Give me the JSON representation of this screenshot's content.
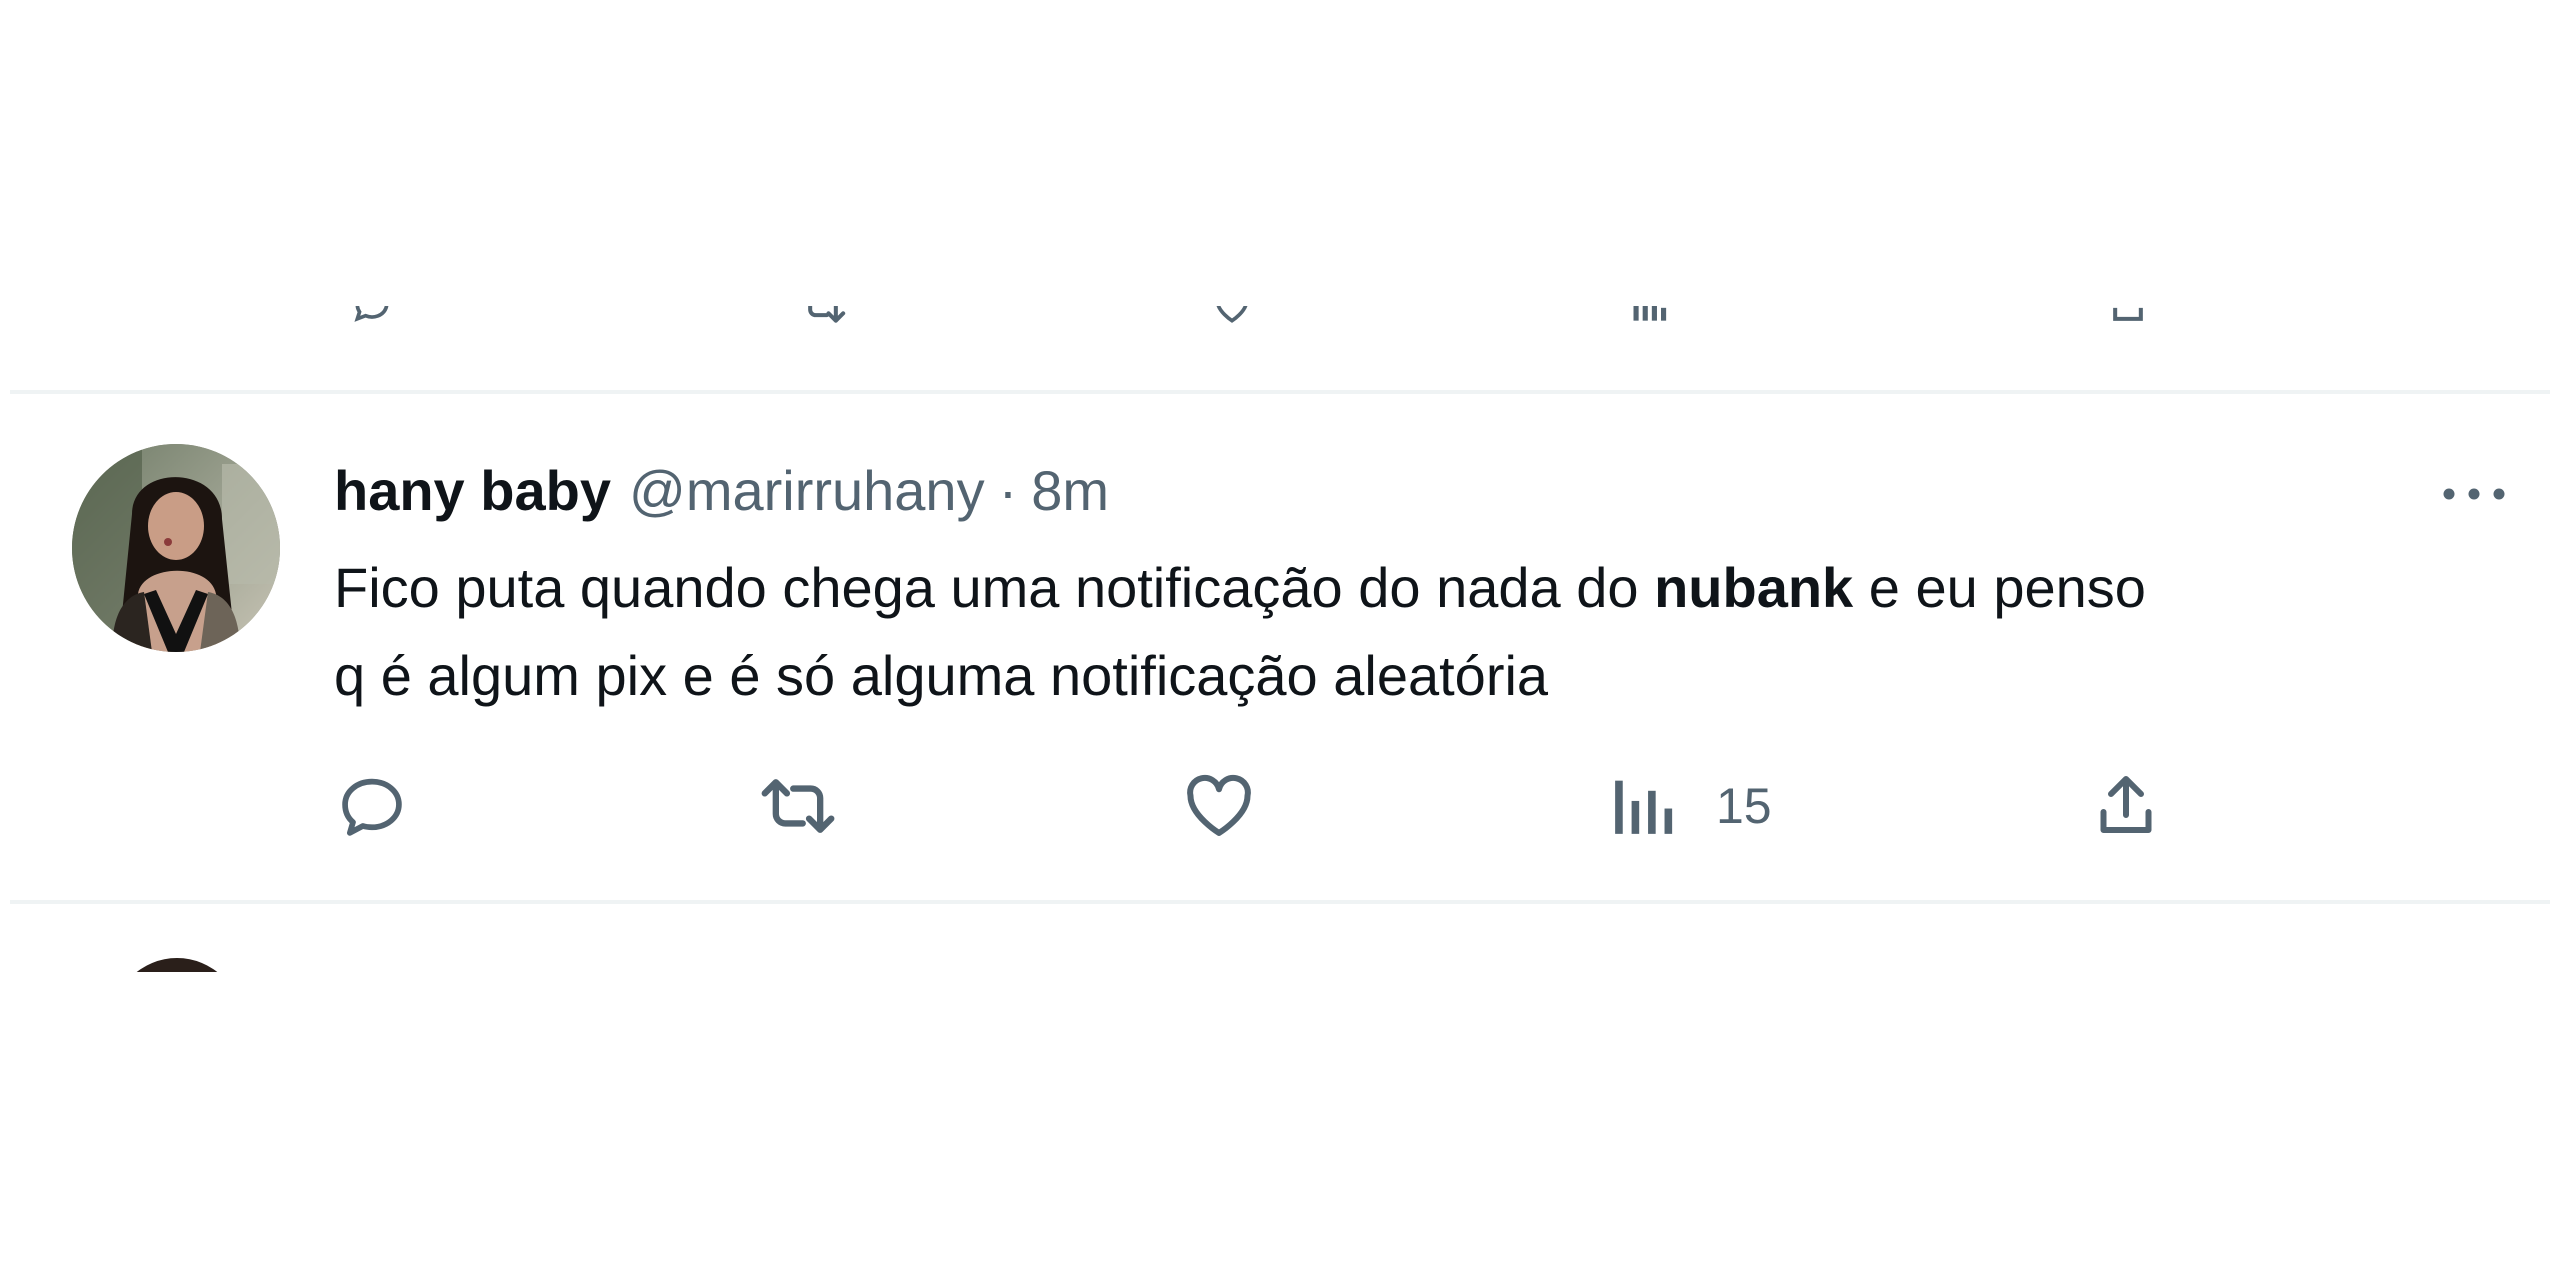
{
  "previous_tweet": {
    "actions": [
      {
        "icon": "reply-icon"
      },
      {
        "icon": "retweet-icon"
      },
      {
        "icon": "like-icon"
      },
      {
        "icon": "views-icon"
      },
      {
        "icon": "share-icon"
      }
    ]
  },
  "tweet": {
    "display_name": "hany baby",
    "handle": "@marirruhany",
    "separator": "·",
    "time": "8m",
    "text_line1_before": "Fico puta quando chega uma notificação do nada do ",
    "text_highlight": "nubank",
    "text_line1_after": " e eu penso",
    "text_line2": "q é algum pix e é só alguma notificação aleatória",
    "more_icon": "more-horizontal-icon",
    "actions": {
      "reply": {
        "icon": "reply-icon"
      },
      "retweet": {
        "icon": "retweet-icon"
      },
      "like": {
        "icon": "heart-icon"
      },
      "views": {
        "icon": "views-icon",
        "count": "15"
      },
      "share": {
        "icon": "share-icon"
      }
    }
  },
  "colors": {
    "text_primary": "#0f1419",
    "text_secondary": "#536471",
    "divider": "#eff3f4",
    "background": "#ffffff"
  }
}
